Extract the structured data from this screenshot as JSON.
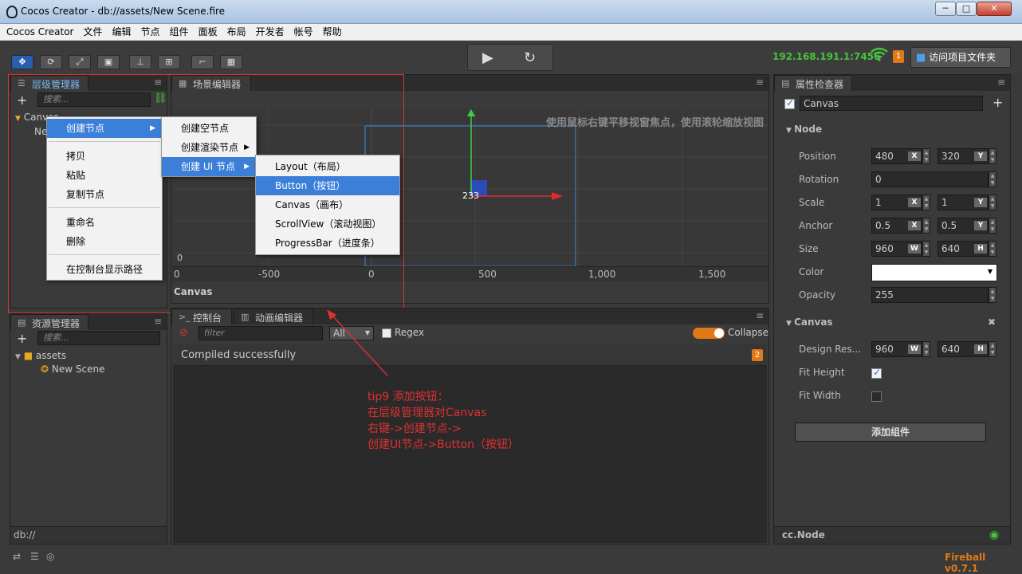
{
  "window": {
    "title": "Cocos Creator - db://assets/New Scene.fire",
    "minimize": "─",
    "maximize": "□",
    "close": "✕"
  },
  "menu": [
    "Cocos Creator",
    "文件",
    "编辑",
    "节点",
    "组件",
    "面板",
    "布局",
    "开发者",
    "帐号",
    "帮助"
  ],
  "toolbar": {
    "tools": [
      "✥",
      "⟳",
      "⤢",
      "▣",
      "⊥",
      "⊞",
      "⌐",
      "▦"
    ],
    "play_icon": "▶",
    "refresh_icon": "↻",
    "ip": "192.168.191.1:7456",
    "badge": "1",
    "open_project_label": "访问项目文件夹"
  },
  "hierarchy": {
    "tab": "层级管理器",
    "search_placeholder": "搜索...",
    "add": "+",
    "tree": [
      {
        "label": "Canvas"
      },
      {
        "label": "Ne"
      }
    ]
  },
  "context_menu": {
    "items": [
      "创建节点",
      "拷贝",
      "粘贴",
      "复制节点",
      "重命名",
      "删除",
      "在控制台显示路径"
    ],
    "submenu1": [
      "创建空节点",
      "创建渲染节点",
      "创建 UI 节点"
    ],
    "submenu2": [
      "Layout（布局）",
      "Button（按钮）",
      "Canvas（画布）",
      "ScrollView（滚动视图）",
      "ProgressBar（进度条）"
    ]
  },
  "scene": {
    "tab": "场景编辑器",
    "hint": "使用鼠标右键平移视窗焦点，使用滚轮缩放视图",
    "footer_label": "Canvas",
    "node_label": "233",
    "ruler_x": [
      "0",
      "-500",
      "0",
      "500",
      "1,000",
      "1,500"
    ],
    "ruler_y": [
      "0"
    ]
  },
  "assets": {
    "tab": "资源管理器",
    "search_placeholder": "搜索...",
    "add": "+",
    "tree": [
      {
        "label": "assets"
      },
      {
        "label": "New Scene"
      }
    ],
    "footer": "db://"
  },
  "console": {
    "tabs": [
      "控制台",
      "动画编辑器"
    ],
    "filter_placeholder": "filter",
    "level": "All",
    "regex_label": "Regex",
    "collapse_label": "Collapse",
    "message": "Compiled successfully",
    "message_count": "2"
  },
  "annotation": {
    "lines": [
      "tip9 添加按钮：",
      "在层级管理器对Canvas",
      "右键->创建节点->",
      "创建UI节点->Button（按钮）"
    ],
    "color": "#e03030"
  },
  "inspector": {
    "tab": "属性检查器",
    "node_name": "Canvas",
    "add": "+",
    "node_section": "Node",
    "props": [
      {
        "label": "Position",
        "a": "480",
        "ax": "X",
        "b": "320",
        "bx": "Y"
      },
      {
        "label": "Rotation",
        "a": "0"
      },
      {
        "label": "Scale",
        "a": "1",
        "ax": "X",
        "b": "1",
        "bx": "Y"
      },
      {
        "label": "Anchor",
        "a": "0.5",
        "ax": "X",
        "b": "0.5",
        "bx": "Y"
      },
      {
        "label": "Size",
        "a": "960",
        "ax": "W",
        "b": "640",
        "bx": "H"
      },
      {
        "label": "Color"
      },
      {
        "label": "Opacity",
        "a": "255"
      }
    ],
    "canvas_section": "Canvas",
    "remove": "✖",
    "canvas_props": [
      {
        "label": "Design Res...",
        "a": "960",
        "ax": "W",
        "b": "640",
        "bx": "H"
      },
      {
        "label": "Fit Height",
        "checked": true
      },
      {
        "label": "Fit Width",
        "checked": false
      }
    ],
    "add_component": "添加组件",
    "footer": "cc.Node"
  },
  "statusbar": {
    "version": "Fireball v0.7.1"
  }
}
